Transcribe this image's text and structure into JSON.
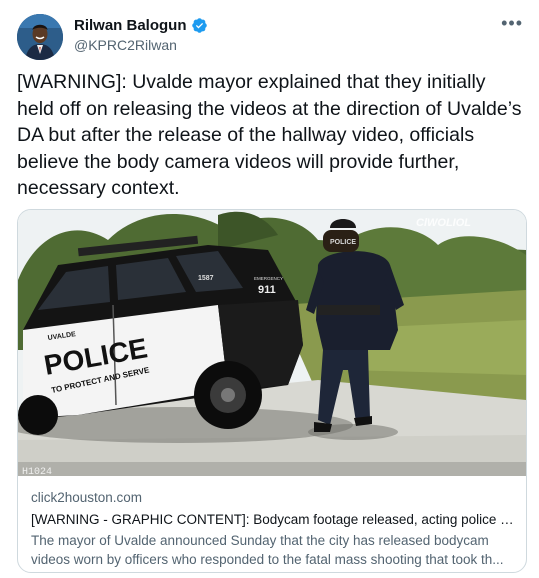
{
  "author": {
    "name": "Rilwan Balogun",
    "handle": "@KPRC2Rilwan",
    "verified_icon": "verified-badge-icon",
    "more_icon": "more-options-icon"
  },
  "tweet": {
    "text": "[WARNING]: Uvalde mayor explained that they initially held off on releasing the videos at the direction of Uvalde’s DA but after the release of the hallway video, officials believe the body camera videos will provide further, necessary context."
  },
  "card": {
    "image_overlay": {
      "watermark": "ClWOLIOL",
      "car_number": "1587",
      "car_emergency_line1": "EMERGENCY",
      "car_emergency_number": "911",
      "car_door_top": "UVALDE",
      "car_door_main": "POLICE",
      "car_door_motto": "TO PROTECT AND SERVE",
      "vest_label": "POLICE",
      "timestamp": "H1024"
    },
    "domain": "click2houston.com",
    "title": "[WARNING - GRAPHIC CONTENT]: Bodycam footage released, acting police c...",
    "description_line1": "The mayor of Uvalde announced Sunday that the city has released bodycam",
    "description_line2": "videos worn by officers who responded to the fatal mass shooting that took th..."
  },
  "colors": {
    "text": "#0f1419",
    "secondary": "#536471",
    "border": "#cfd9de",
    "verified": "#1d9bf0"
  }
}
